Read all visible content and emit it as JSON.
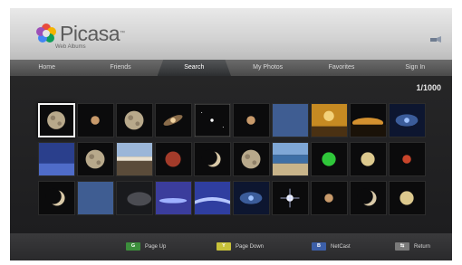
{
  "app": {
    "title": "Picasa",
    "subtitle": "Web Albums"
  },
  "tabs": [
    {
      "label": "Home",
      "active": false
    },
    {
      "label": "Friends",
      "active": false
    },
    {
      "label": "Search",
      "active": true
    },
    {
      "label": "My Photos",
      "active": false
    },
    {
      "label": "Favorites",
      "active": false
    },
    {
      "label": "Sign In",
      "active": false
    }
  ],
  "page_indicator": "1/1000",
  "thumbnails": [
    {
      "icon": "moon-photo",
      "selected": true
    },
    {
      "icon": "small-planet-photo"
    },
    {
      "icon": "moon-photo"
    },
    {
      "icon": "galaxy-photo"
    },
    {
      "icon": "star-field-photo"
    },
    {
      "icon": "small-planet-photo"
    },
    {
      "icon": "blue-sky-photo"
    },
    {
      "icon": "golden-sunset-photo"
    },
    {
      "icon": "horizon-glow-photo"
    },
    {
      "icon": "blue-nebula-photo"
    },
    {
      "icon": "blue-water-photo"
    },
    {
      "icon": "moon-photo"
    },
    {
      "icon": "landscape-horizon-photo"
    },
    {
      "icon": "red-moon-photo"
    },
    {
      "icon": "crescent-moon-photo"
    },
    {
      "icon": "moon-photo"
    },
    {
      "icon": "beach-photo"
    },
    {
      "icon": "green-planet-photo"
    },
    {
      "icon": "full-moon-photo"
    },
    {
      "icon": "red-planet-photo"
    },
    {
      "icon": "crescent-moon-photo"
    },
    {
      "icon": "blue-sky-photo"
    },
    {
      "icon": "grey-cloud-photo"
    },
    {
      "icon": "purple-sky-photo"
    },
    {
      "icon": "aurora-photo"
    },
    {
      "icon": "blue-nebula-photo"
    },
    {
      "icon": "bright-star-photo"
    },
    {
      "icon": "small-planet-photo"
    },
    {
      "icon": "crescent-moon-photo"
    },
    {
      "icon": "full-moon-photo"
    }
  ],
  "footer": [
    {
      "key": "G",
      "label": "Page Up",
      "color": "#3c8e3c"
    },
    {
      "key": "Y",
      "label": "Page Down",
      "color": "#c8c23a"
    },
    {
      "key": "B",
      "label": "NetCast",
      "color": "#3c5fa8"
    },
    {
      "key": "⇆",
      "label": "Return",
      "color": "#7a7a7a"
    }
  ],
  "colors": {
    "accent": "#2d2f31",
    "background": "#1d1d1f"
  }
}
